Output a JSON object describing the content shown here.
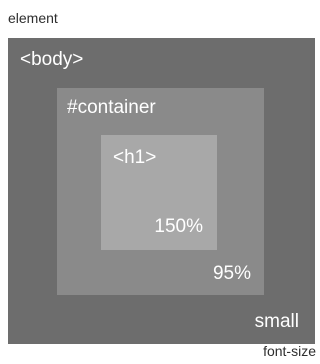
{
  "labels": {
    "element": "element",
    "font_size": "font-size"
  },
  "boxes": {
    "body": {
      "element": "<body>",
      "font_size": "small"
    },
    "container": {
      "element": "#container",
      "font_size": "95%"
    },
    "h1": {
      "element": "<h1>",
      "font_size": "150%"
    }
  },
  "colors": {
    "body_box": "#6d6d6d",
    "container_box": "#8a8a8a",
    "h1_box": "#a8a8a8",
    "box_text": "#ffffff",
    "caption_text": "#2e2e2e"
  }
}
